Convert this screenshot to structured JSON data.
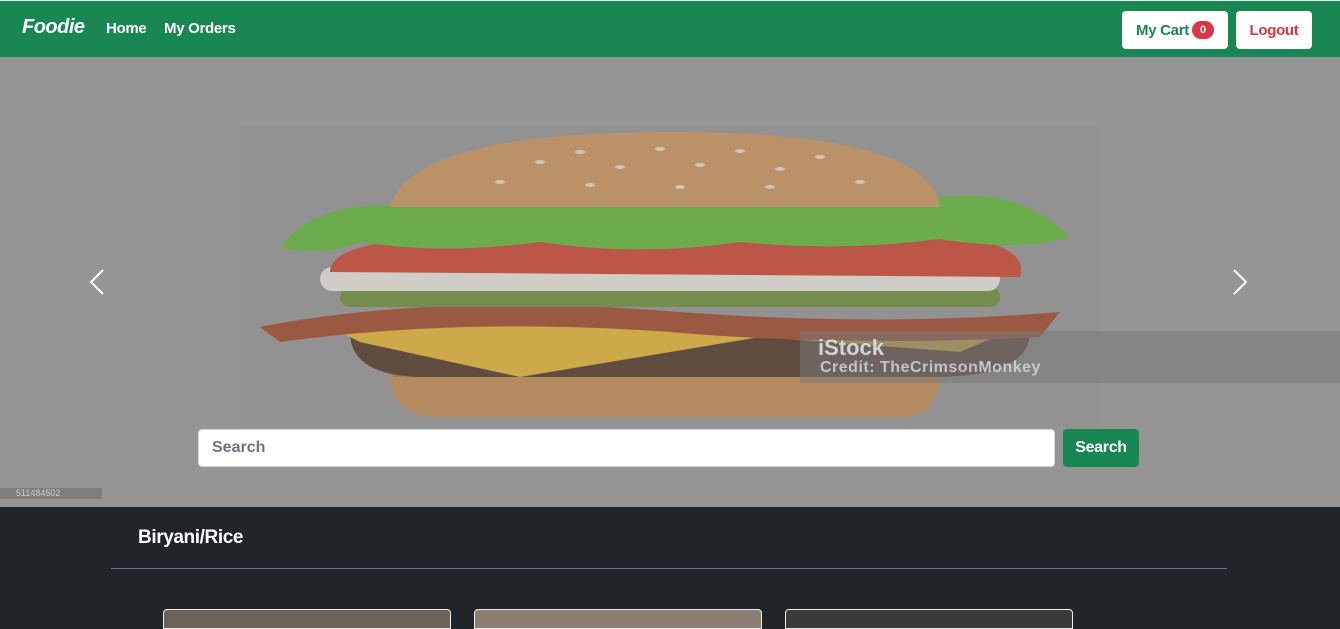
{
  "navbar": {
    "brand": "Foodie",
    "links": [
      "Home",
      "My Orders"
    ],
    "cart_label": "My Cart",
    "cart_count": "0",
    "logout_label": "Logout"
  },
  "carousel": {
    "watermark_brand": "iStock",
    "watermark_credit": "Credit: TheCrimsonMonkey",
    "stock_id": "511484502"
  },
  "search": {
    "placeholder": "Search",
    "button_label": "Search"
  },
  "category": {
    "title": "Biryani/Rice"
  },
  "colors": {
    "primary": "#198754",
    "danger": "#dc3545",
    "dark": "#212529"
  }
}
